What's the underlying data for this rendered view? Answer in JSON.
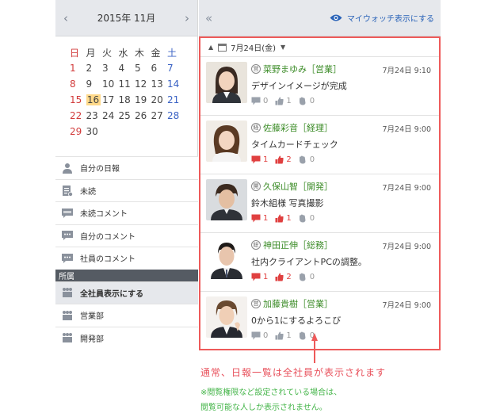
{
  "calendar": {
    "title": "2015年 11月",
    "prev": "‹",
    "next": "›",
    "weekdays": [
      "日",
      "月",
      "火",
      "水",
      "木",
      "金",
      "土"
    ],
    "weeks": [
      [
        "1",
        "2",
        "3",
        "4",
        "5",
        "6",
        "7"
      ],
      [
        "8",
        "9",
        "10",
        "11",
        "12",
        "13",
        "14"
      ],
      [
        "15",
        "16",
        "17",
        "18",
        "19",
        "20",
        "21"
      ],
      [
        "22",
        "23",
        "24",
        "25",
        "26",
        "27",
        "28"
      ],
      [
        "29",
        "30",
        "",
        "",
        "",
        "",
        ""
      ]
    ],
    "today": "16"
  },
  "menu": {
    "items": [
      {
        "label": "自分の日報",
        "icon": "person-icon"
      },
      {
        "label": "未読",
        "icon": "document-icon"
      },
      {
        "label": "未読コメント",
        "icon": "new-comment-icon"
      },
      {
        "label": "自分のコメント",
        "icon": "comment-icon"
      },
      {
        "label": "社員のコメント",
        "icon": "comment-icon"
      }
    ],
    "section_label": "所属",
    "groups": [
      {
        "label": "全社員表示にする",
        "active": true
      },
      {
        "label": "営業部",
        "active": false
      },
      {
        "label": "開発部",
        "active": false
      }
    ]
  },
  "header": {
    "collapse": "«",
    "watch_label": "マイウォッチ表示にする"
  },
  "feed": {
    "date_label": "7月24日(金)",
    "entries": [
      {
        "badge": "営",
        "name": "菜野まゆみ［営業］",
        "time": "7月24日 9:10",
        "title": "デザインイメージが完成",
        "comments": "0",
        "likes": "1",
        "reads": "0",
        "hot": false
      },
      {
        "badge": "経",
        "name": "佐藤彩音［経理］",
        "time": "7月24日 9:00",
        "title": "タイムカードチェック",
        "comments": "1",
        "likes": "2",
        "reads": "0",
        "hot": true
      },
      {
        "badge": "開",
        "name": "久保山智［開発］",
        "time": "7月24日 9:00",
        "title": "鈴木組様 写真撮影",
        "comments": "1",
        "likes": "1",
        "reads": "0",
        "hot": true
      },
      {
        "badge": "総",
        "name": "神田正伸［総務］",
        "time": "7月24日 9:00",
        "title": "社内クライアントPCの調整。",
        "comments": "1",
        "likes": "2",
        "reads": "0",
        "hot": true
      },
      {
        "badge": "営",
        "name": "加藤貴樹［営業］",
        "time": "7月24日 9:00",
        "title": "0から1にするよろこび",
        "comments": "0",
        "likes": "1",
        "reads": "0",
        "hot": false
      }
    ]
  },
  "annotation": {
    "line1": "通常、日報一覧は全社員が表示されます",
    "line2": "※閲覧権限など設定されている場合は、",
    "line3": "閲覧可能な人しか表示されません。"
  },
  "colors": {
    "accent_red": "#ee5a5a",
    "name_green": "#3c8c28",
    "note_green": "#45b54a",
    "link_blue": "#2a63b8"
  }
}
